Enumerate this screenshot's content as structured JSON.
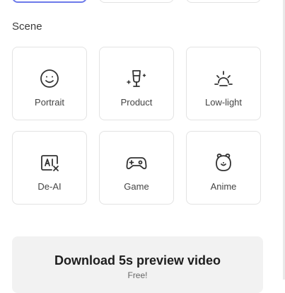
{
  "scene": {
    "section_label": "Scene",
    "items": [
      {
        "label": "Portrait",
        "icon": "smile-face-icon"
      },
      {
        "label": "Product",
        "icon": "product-sparkle-icon"
      },
      {
        "label": "Low-light",
        "icon": "sunrise-icon"
      },
      {
        "label": "De-AI",
        "icon": "ai-remove-icon"
      },
      {
        "label": "Game",
        "icon": "gamepad-icon"
      },
      {
        "label": "Anime",
        "icon": "bear-face-icon"
      }
    ]
  },
  "download": {
    "title": "Download 5s preview video",
    "subtitle": "Free!"
  },
  "colors": {
    "selected_border": "#6c79ea",
    "card_border": "#e3e3e3",
    "button_bg": "#f2f2f2"
  }
}
